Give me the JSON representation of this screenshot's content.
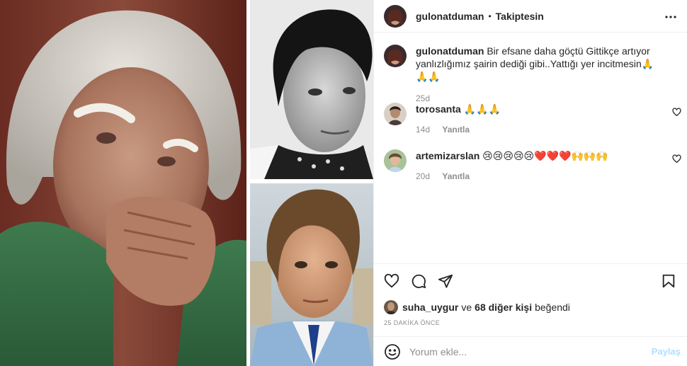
{
  "post": {
    "author": "gulonatduman",
    "follow_status": "Takiptesin",
    "caption_user": "gulonatduman",
    "caption_text": "Bir efsane daha göçtü Gittikçe artıyor yanlızlığımız şairin dediği gibi..Yattığı yer incitmesin🙏🙏🙏",
    "caption_age": "25d"
  },
  "comments": [
    {
      "user": "torosanta",
      "text": "🙏🙏🙏",
      "age": "14d",
      "reply": "Yanıtla"
    },
    {
      "user": "artemizarslan",
      "text": "😢😢😢😢😢❤️❤️❤️🙌🙌🙌",
      "age": "20d",
      "reply": "Yanıtla"
    }
  ],
  "likes": {
    "liker": "suha_uygur",
    "connector": "ve",
    "others": "68 diğer kişi",
    "suffix": "beğendi"
  },
  "timestamp": "25 DAKİKA ÖNCE",
  "comment_box": {
    "placeholder": "Yorum ekle...",
    "post_label": "Paylaş"
  },
  "icons": {
    "more": "more-horizontal-icon",
    "like": "heart-icon",
    "comment": "comment-icon",
    "share": "send-icon",
    "save": "bookmark-icon",
    "emoji": "smiley-icon"
  },
  "colors": {
    "text": "#262626",
    "muted": "#8e8e8e",
    "border": "#efefef",
    "post_disabled": "#b2dffc"
  }
}
